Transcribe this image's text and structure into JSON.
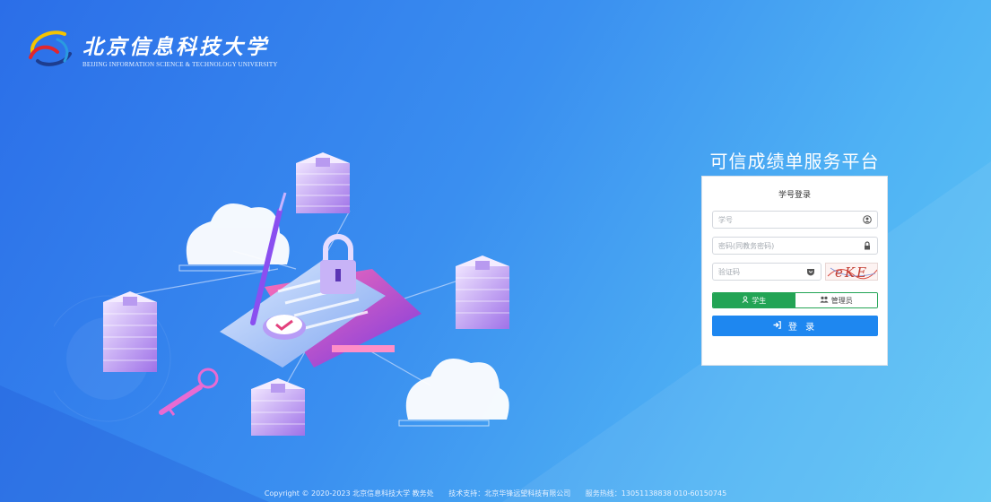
{
  "brand": {
    "name_cn": "北京信息科技大学",
    "name_en": "Beijing Information Science & Technology University",
    "logo_icon": "bistu-logo-icon"
  },
  "platform": {
    "title": "可信成绩单服务平台"
  },
  "login": {
    "card_title": "学号登录",
    "fields": {
      "student_id": {
        "placeholder": "学号",
        "icon": "user-circle-icon"
      },
      "password": {
        "placeholder": "密码(同教务密码)",
        "icon": "lock-icon"
      },
      "captcha": {
        "placeholder": "验证码",
        "icon": "shield-icon"
      }
    },
    "captcha_text": "eKE",
    "roles": [
      {
        "label": "学生",
        "icon": "user-icon",
        "selected": true
      },
      {
        "label": "管理员",
        "icon": "users-icon",
        "selected": false
      }
    ],
    "submit_label": "登 录",
    "submit_icon": "sign-in-icon"
  },
  "footer": {
    "copyright": "Copyright © 2020-2023 北京信息科技大学 教务处",
    "tech_support": "技术支持：北京华锋远望科技有限公司",
    "hotline": "服务热线：13051138838 010-60150745"
  },
  "colors": {
    "background_start": "#2b6ee8",
    "background_end": "#5ec6f5",
    "primary_button": "#1e87f0",
    "role_active": "#23a455"
  }
}
